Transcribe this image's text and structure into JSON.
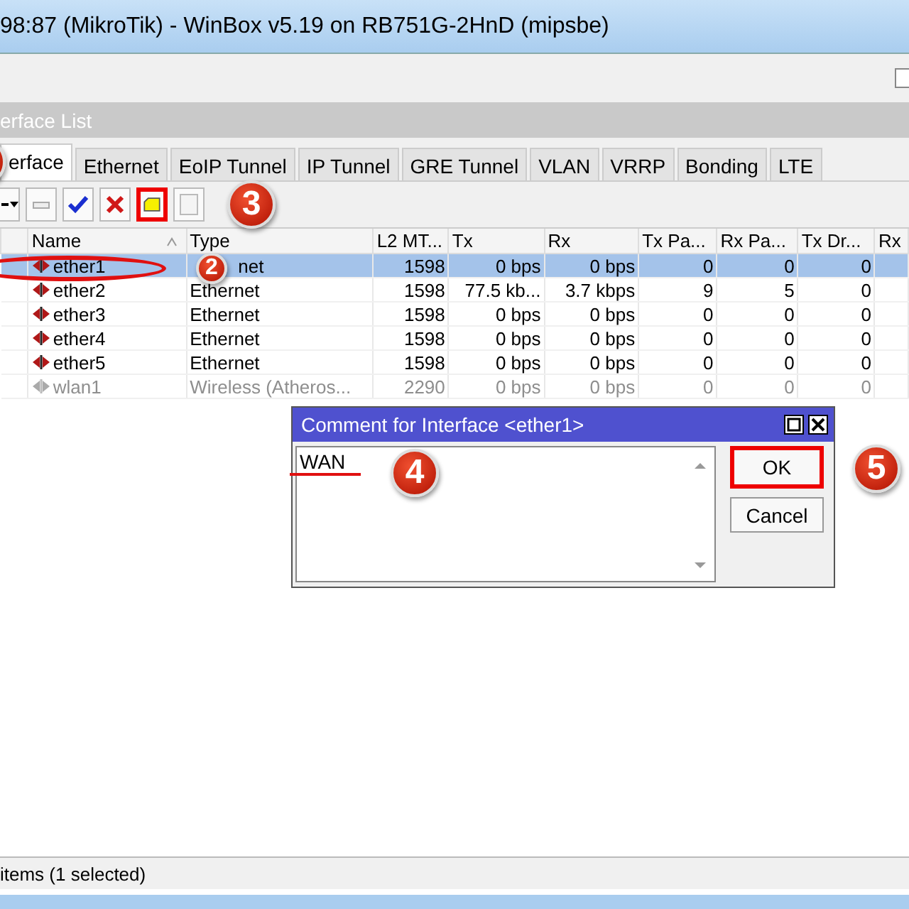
{
  "window": {
    "title": "98:87 (MikroTik) - WinBox v5.19 on RB751G-2HnD (mipsbe)"
  },
  "panel": {
    "title": "erface List"
  },
  "tabs": [
    {
      "label": "erface",
      "selected": true
    },
    {
      "label": "Ethernet",
      "selected": false
    },
    {
      "label": "EoIP Tunnel",
      "selected": false
    },
    {
      "label": "IP Tunnel",
      "selected": false
    },
    {
      "label": "GRE Tunnel",
      "selected": false
    },
    {
      "label": "VLAN",
      "selected": false
    },
    {
      "label": "VRRP",
      "selected": false
    },
    {
      "label": "Bonding",
      "selected": false
    },
    {
      "label": "LTE",
      "selected": false
    }
  ],
  "toolbar": [
    {
      "kind": "dropdown",
      "highlighted": false
    },
    {
      "kind": "minus",
      "highlighted": false
    },
    {
      "kind": "enable",
      "highlighted": false
    },
    {
      "kind": "disable",
      "highlighted": false
    },
    {
      "kind": "comment",
      "highlighted": true
    },
    {
      "kind": "blank",
      "highlighted": false
    }
  ],
  "table": {
    "columns": [
      "Name",
      "Type",
      "L2 MT...",
      "Tx",
      "Rx",
      "Tx Pa...",
      "Rx Pa...",
      "Tx Dr...",
      "Rx"
    ],
    "rows": [
      {
        "selected": true,
        "disabled": false,
        "cells": [
          "ether1",
          "net",
          "1598",
          "0 bps",
          "0 bps",
          "0",
          "0",
          "0"
        ]
      },
      {
        "selected": false,
        "disabled": false,
        "cells": [
          "ether2",
          "Ethernet",
          "1598",
          "77.5 kb...",
          "3.7 kbps",
          "9",
          "5",
          "0"
        ]
      },
      {
        "selected": false,
        "disabled": false,
        "cells": [
          "ether3",
          "Ethernet",
          "1598",
          "0 bps",
          "0 bps",
          "0",
          "0",
          "0"
        ]
      },
      {
        "selected": false,
        "disabled": false,
        "cells": [
          "ether4",
          "Ethernet",
          "1598",
          "0 bps",
          "0 bps",
          "0",
          "0",
          "0"
        ]
      },
      {
        "selected": false,
        "disabled": false,
        "cells": [
          "ether5",
          "Ethernet",
          "1598",
          "0 bps",
          "0 bps",
          "0",
          "0",
          "0"
        ]
      },
      {
        "selected": false,
        "disabled": true,
        "cells": [
          "wlan1",
          "Wireless (Atheros...",
          "2290",
          "0 bps",
          "0 bps",
          "0",
          "0",
          "0"
        ]
      }
    ]
  },
  "status_bar": "items (1 selected)",
  "dialog": {
    "title": "Comment for Interface <ether1>",
    "value": "WAN",
    "buttons": [
      {
        "label": "OK",
        "highlighted": true
      },
      {
        "label": "Cancel",
        "highlighted": false
      }
    ]
  },
  "menu_bar": {
    "checkbox": {
      "checked": false
    }
  },
  "annotations": [
    {
      "kind": "step"
    },
    {
      "kind": "step",
      "label": "2"
    },
    {
      "kind": "step",
      "label": "3"
    },
    {
      "kind": "step",
      "label": "4"
    },
    {
      "kind": "step",
      "label": "5"
    }
  ]
}
